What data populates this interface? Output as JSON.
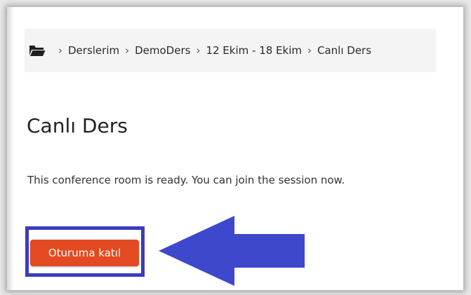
{
  "breadcrumb": {
    "items": [
      "Derslerim",
      "DemoDers",
      "12 Ekim - 18 Ekim",
      "Canlı Ders"
    ],
    "separator": "›"
  },
  "page": {
    "title": "Canlı Ders",
    "status": "This conference room is ready. You can join the session now."
  },
  "join_button": {
    "label": "Oturuma katıl",
    "color": "#e34a21"
  },
  "annotation": {
    "box_color": "#3b3bbf",
    "arrow_color": "#3e48cc"
  },
  "icons": {
    "breadcrumb_home": "folder-open-icon"
  }
}
